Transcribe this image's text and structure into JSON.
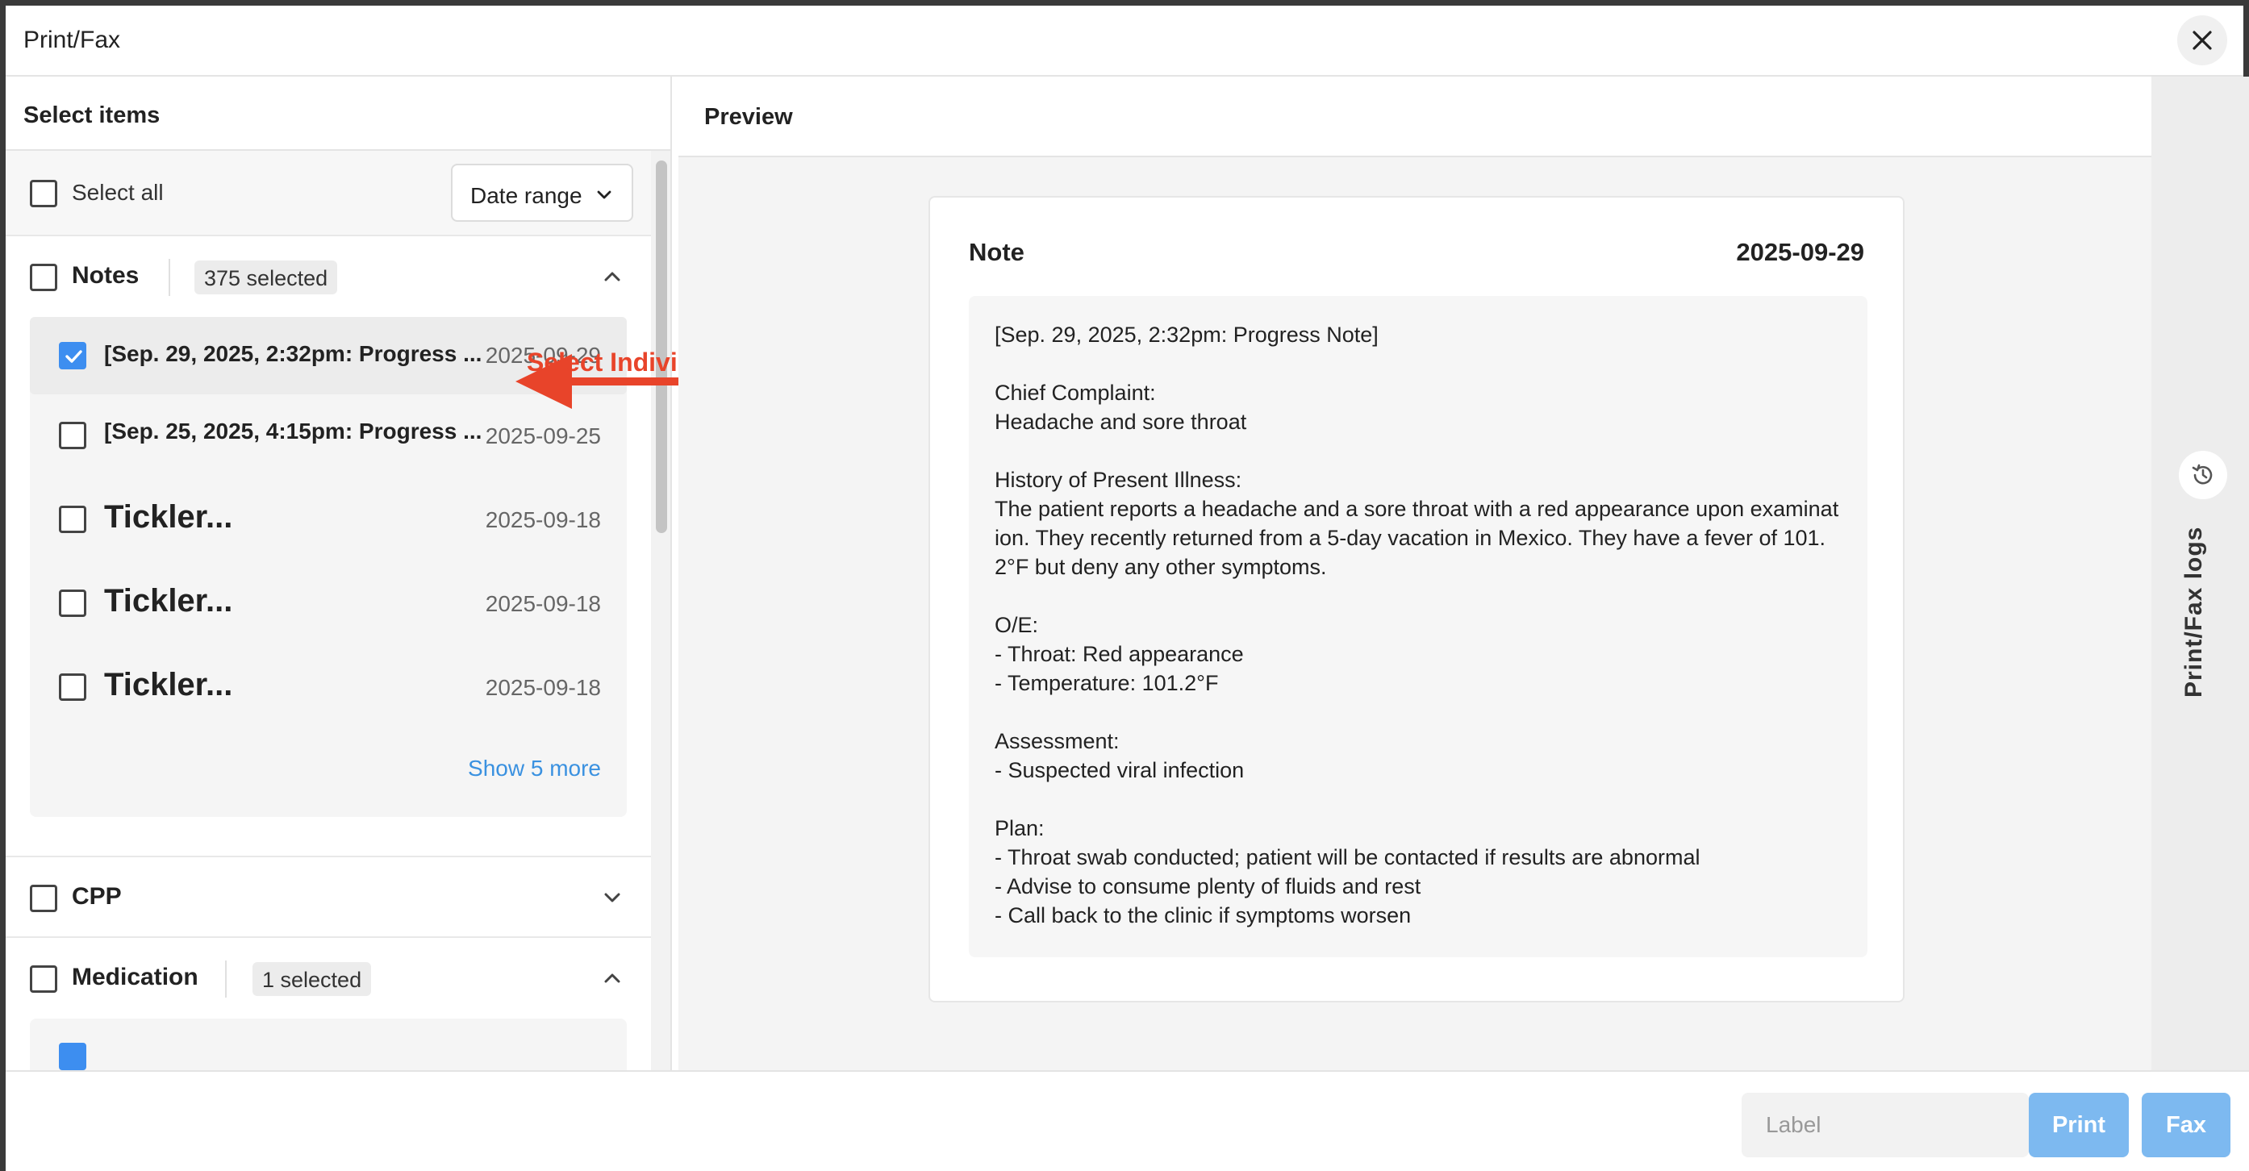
{
  "window": {
    "title": "Print/Fax"
  },
  "left_panel": {
    "heading": "Select items",
    "select_all_label": "Select all",
    "date_range_label": "Date range",
    "sections": {
      "notes": {
        "label": "Notes",
        "badge": "375 selected",
        "expanded": true,
        "items": [
          {
            "title": "[Sep. 29, 2025, 2:32pm: Progress ...",
            "date": "2025-09-29",
            "checked": true
          },
          {
            "title": "[Sep. 25, 2025, 4:15pm: Progress ...",
            "date": "2025-09-25",
            "checked": false
          },
          {
            "title": "Tickler...",
            "date": "2025-09-18",
            "checked": false
          },
          {
            "title": "Tickler...",
            "date": "2025-09-18",
            "checked": false
          },
          {
            "title": "Tickler...",
            "date": "2025-09-18",
            "checked": false
          }
        ],
        "show_more": "Show 5 more"
      },
      "cpp": {
        "label": "CPP",
        "expanded": false
      },
      "medication": {
        "label": "Medication",
        "badge": "1 selected",
        "expanded": true
      }
    }
  },
  "annotation": {
    "text": "Select Individually",
    "color": "#e8442a"
  },
  "preview": {
    "heading": "Preview",
    "note": {
      "title": "Note",
      "date": "2025-09-29",
      "body": "[Sep. 29, 2025, 2:32pm: Progress Note]\n\nChief Complaint:\nHeadache and sore throat\n\nHistory of Present Illness:\nThe patient reports a headache and a sore throat with a red appearance upon examination. They recently returned from a 5-day vacation in Mexico. They have a fever of 101.2°F but deny any other symptoms.\n\nO/E:\n- Throat: Red appearance\n- Temperature: 101.2°F\n\nAssessment:\n- Suspected viral infection\n\nPlan:\n- Throat swab conducted; patient will be contacted if results are abnormal\n- Advise to consume plenty of fluids and rest\n- Call back to the clinic if symptoms worsen"
    }
  },
  "side": {
    "logs_label": "Print/Fax logs",
    "icon": "history-icon"
  },
  "footer": {
    "label_placeholder": "Label",
    "label_value": "",
    "print_label": "Print",
    "fax_label": "Fax"
  },
  "colors": {
    "accent": "#3d8ef0",
    "button": "#7db9f0",
    "link": "#3a91e0"
  }
}
